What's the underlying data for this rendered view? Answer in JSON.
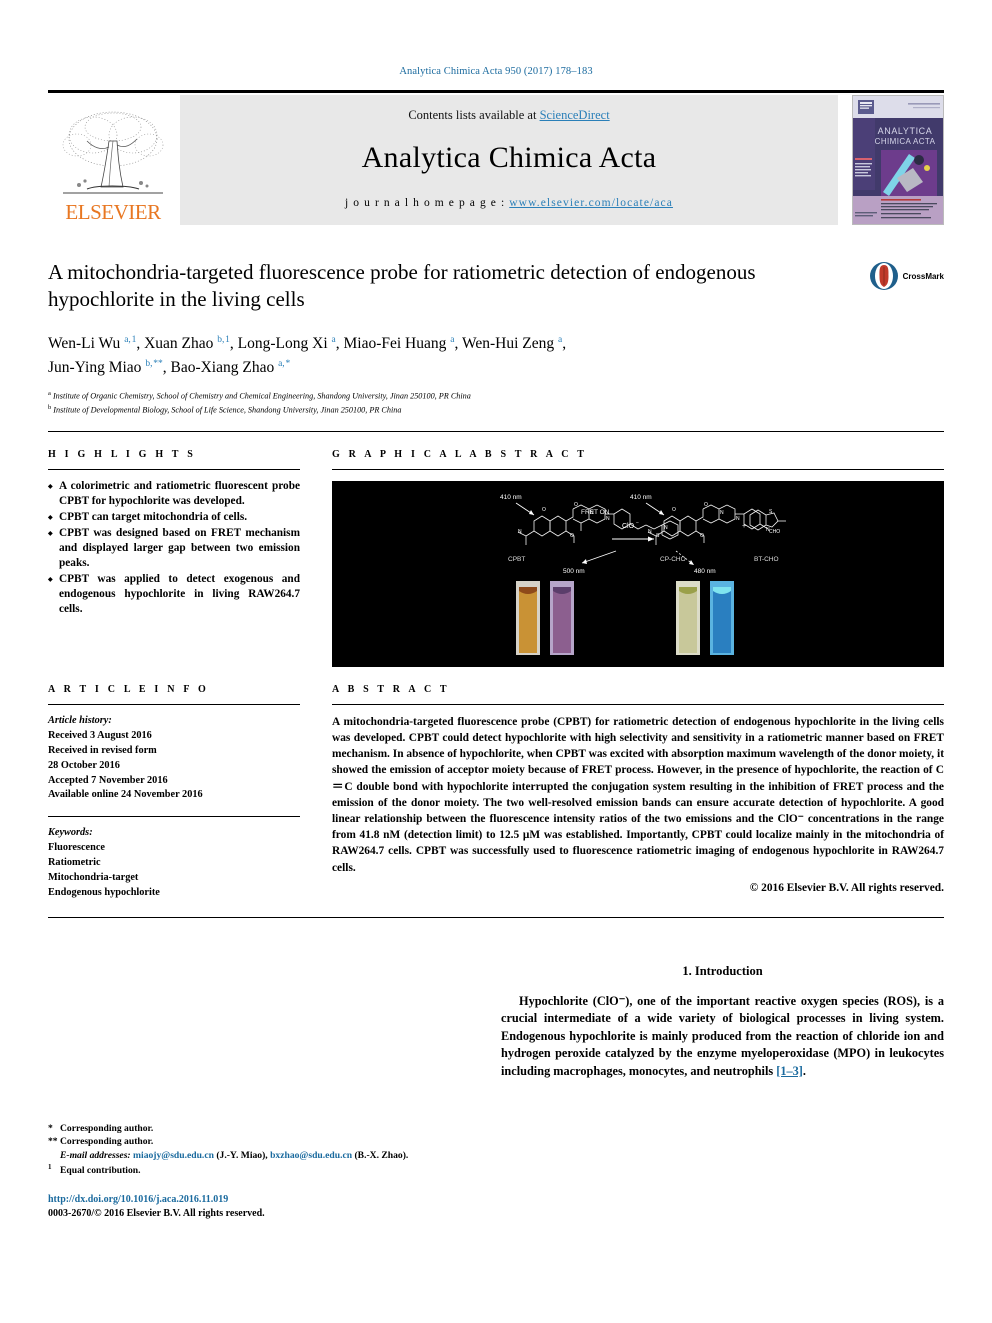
{
  "running_head": "Analytica Chimica Acta 950 (2017) 178–183",
  "masthead": {
    "contents_prefix": "Contents lists available at ",
    "sciencedirect": "ScienceDirect",
    "journal_title": "Analytica Chimica Acta",
    "homepage_prefix": "j o u r n a l   h o m e p a g e :  ",
    "homepage_url": "www.elsevier.com/locate/aca",
    "publisher": "ELSEVIER",
    "cover_title_line1": "ANALYTICA",
    "cover_title_line2": "CHIMICA ACTA",
    "link_color": "#2a7fb8"
  },
  "article": {
    "title": "A mitochondria-targeted fluorescence probe for ratiometric detection of endogenous hypochlorite in the living cells",
    "crossmark_label": "CrossMark",
    "authors_line1": "Wen-Li Wu a, 1, Xuan Zhao b, 1, Long-Long Xi a, Miao-Fei Huang a, Wen-Hui Zeng a,",
    "authors_line2": "Jun-Ying Miao b, **, Bao-Xiang Zhao a, *",
    "authors": [
      {
        "name": "Wen-Li Wu",
        "sup": "a, 1"
      },
      {
        "name": "Xuan Zhao",
        "sup": "b, 1"
      },
      {
        "name": "Long-Long Xi",
        "sup": "a"
      },
      {
        "name": "Miao-Fei Huang",
        "sup": "a"
      },
      {
        "name": "Wen-Hui Zeng",
        "sup": "a"
      },
      {
        "name": "Jun-Ying Miao",
        "sup": "b, **"
      },
      {
        "name": "Bao-Xiang Zhao",
        "sup": "a, *"
      }
    ],
    "affiliations": [
      {
        "mark": "a",
        "text": "Institute of Organic Chemistry, School of Chemistry and Chemical Engineering, Shandong University, Jinan 250100, PR China"
      },
      {
        "mark": "b",
        "text": "Institute of Developmental Biology, School of Life Science, Shandong University, Jinan 250100, PR China"
      }
    ]
  },
  "highlights": {
    "heading": "H I G H L I G H T S",
    "items": [
      "A colorimetric and ratiometric fluorescent probe CPBT for hypochlorite was developed.",
      "CPBT can target mitochondria of cells.",
      "CPBT was designed based on FRET mechanism and displayed larger gap between two emission peaks.",
      "CPBT was applied to detect exogenous and endogenous hypochlorite in living RAW264.7 cells."
    ]
  },
  "graphical_abstract": {
    "heading": "G R A P H I C A L   A B S T R A C T",
    "labels": {
      "excitation_left": "410 nm",
      "emission_left": "500 nm",
      "fret_state": "FRET ON",
      "reagent": "ClO⁻",
      "excitation_right": "410 nm",
      "emission_right": "480 nm",
      "compound_left": "CPBT",
      "compound_right1": "CP-CHO",
      "compound_right2": "BT-CHO",
      "plus": "+"
    },
    "cuvettes": [
      {
        "name": "cpbt-daylight",
        "color": "#c99235"
      },
      {
        "name": "cpbt-uv",
        "color": "#8c5f8f"
      },
      {
        "name": "product-daylight",
        "color": "#c8c89a"
      },
      {
        "name": "product-uv",
        "color": "#36a9d8"
      }
    ]
  },
  "article_info": {
    "heading": "A R T I C L E   I N F O",
    "history_label": "Article history:",
    "history": [
      "Received 3 August 2016",
      "Received in revised form",
      "28 October 2016",
      "Accepted 7 November 2016",
      "Available online 24 November 2016"
    ],
    "keywords_label": "Keywords:",
    "keywords": [
      "Fluorescence",
      "Ratiometric",
      "Mitochondria-target",
      "Endogenous hypochlorite"
    ]
  },
  "abstract": {
    "heading": "A B S T R A C T",
    "text": "A mitochondria-targeted fluorescence probe (CPBT) for ratiometric detection of endogenous hypochlorite in the living cells was developed. CPBT could detect hypochlorite with high selectivity and sensitivity in a ratiometric manner based on FRET mechanism. In absence of hypochlorite, when CPBT was excited with absorption maximum wavelength of the donor moiety, it showed the emission of acceptor moiety because of FRET process. However, in the presence of hypochlorite, the reaction of C＝C double bond with hypochlorite interrupted the conjugation system resulting in the inhibition of FRET process and the emission of the donor moiety. The two well-resolved emission bands can ensure accurate detection of hypochlorite. A good linear relationship between the fluorescence intensity ratios of the two emissions and the ClO⁻ concentrations in the range from 41.8 nM (detection limit) to 12.5 μM was established. Importantly, CPBT could localize mainly in the mitochondria of RAW264.7 cells. CPBT was successfully used to fluorescence ratiometric imaging of endogenous hypochlorite in RAW264.7 cells.",
    "copyright": "© 2016 Elsevier B.V. All rights reserved."
  },
  "introduction": {
    "heading": "1.  Introduction",
    "paragraph_pre": "Hypochlorite (ClO",
    "paragraph": "Hypochlorite (ClO⁻), one of the important reactive oxygen species (ROS), is a crucial intermediate of a wide variety of biological processes in living system. Endogenous hypochlorite is mainly produced from the reaction of chloride ion and hydrogen peroxide catalyzed by the enzyme myeloperoxidase (MPO) in leukocytes including macrophages, monocytes, and neutrophils ",
    "citation": "[1–3]",
    "paragraph_end": "."
  },
  "footnotes": {
    "corr1_mark": "*",
    "corr1": "Corresponding author.",
    "corr2_mark": "**",
    "corr2": "Corresponding author.",
    "email_label": "E-mail addresses:",
    "email1": "miaojy@sdu.edu.cn",
    "email1_owner": "(J.-Y. Miao),",
    "email2": "bxzhao@sdu.edu.cn",
    "email2_owner": "(B.-X. Zhao).",
    "equal_mark": "1",
    "equal": "Equal contribution.",
    "doi": "http://dx.doi.org/10.1016/j.aca.2016.11.019",
    "issn_line": "0003-2670/© 2016 Elsevier B.V. All rights reserved."
  }
}
